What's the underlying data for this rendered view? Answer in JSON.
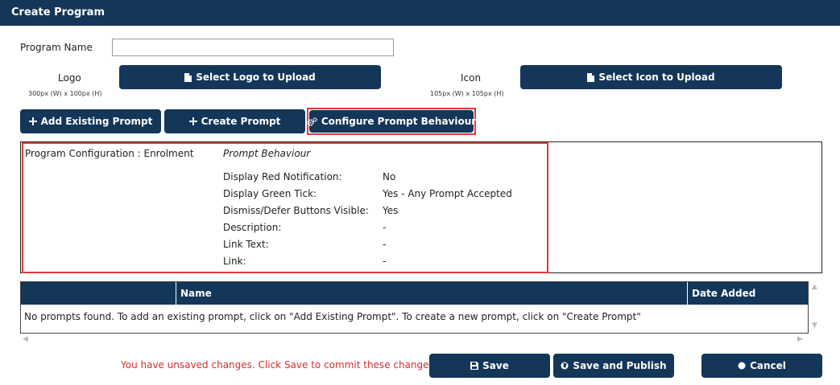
{
  "window": {
    "title": "Create Program"
  },
  "form": {
    "program_name_label": "Program Name",
    "program_name_value": "",
    "logo_label": "Logo",
    "logo_size_hint": "300px (W) x 100px (H)",
    "logo_button": "Select Logo to Upload",
    "icon_label": "Icon",
    "icon_size_hint": "105px (W) x 105px (H)",
    "icon_button": "Select Icon to Upload"
  },
  "actions": {
    "add_existing": "Add Existing Prompt",
    "create_prompt": "Create Prompt",
    "configure": "Configure Prompt Behaviour"
  },
  "config": {
    "program_label": "Program Configuration : Enrolment",
    "section_title": "Prompt Behaviour",
    "rows": [
      {
        "label": "Display Red Notification:",
        "value": "No"
      },
      {
        "label": "Display Green Tick:",
        "value": "Yes - Any Prompt Accepted"
      },
      {
        "label": "Dismiss/Defer Buttons Visible:",
        "value": "Yes"
      },
      {
        "label": "Description:",
        "value": "-"
      },
      {
        "label": "Link Text:",
        "value": "-"
      },
      {
        "label": "Link:",
        "value": "-"
      }
    ]
  },
  "table": {
    "columns": [
      "",
      "Name",
      "Date Added"
    ],
    "empty_message": "No prompts found. To add an existing prompt, click on \"Add Existing Prompt\". To create a new prompt, click on \"Create Prompt\""
  },
  "footer": {
    "unsaved_message": "You have unsaved changes. Click Save to commit these changes.",
    "save": "Save",
    "save_publish": "Save and Publish",
    "cancel": "Cancel"
  },
  "colors": {
    "primary": "#133659",
    "highlight": "#e53935",
    "warning_text": "#d32f2f"
  },
  "icons": {
    "upload": "file-icon",
    "add": "plus-icon",
    "configure": "cogs-icon",
    "save": "floppy-icon",
    "publish": "globe-icon",
    "cancel": "circle-icon"
  }
}
